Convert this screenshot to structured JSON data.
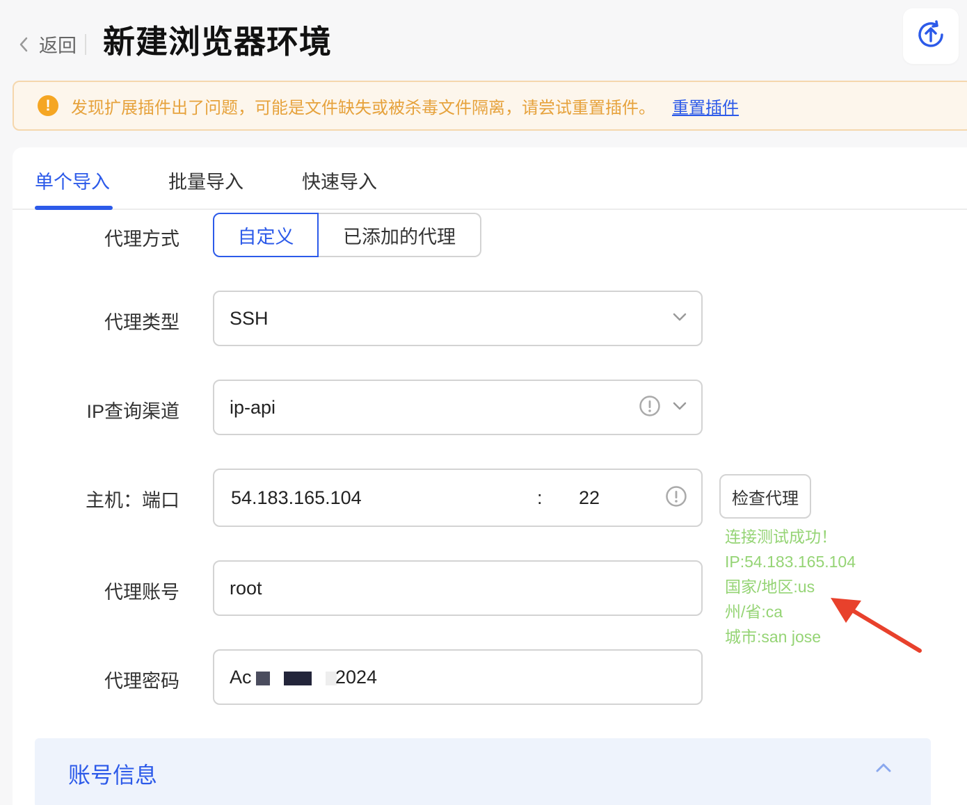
{
  "header": {
    "back_label": "返回",
    "title": "新建浏览器环境",
    "upload_icon": "upload-sync-icon"
  },
  "banner": {
    "icon": "warning-icon",
    "message": "发现扩展插件出了问题，可能是文件缺失或被杀毒文件隔离，请尝试重置插件。",
    "link": "重置插件",
    "color": "#e6a23c"
  },
  "tabs": [
    {
      "label": "单个导入",
      "active": true
    },
    {
      "label": "批量导入",
      "active": false
    },
    {
      "label": "快速导入",
      "active": false
    }
  ],
  "form": {
    "proxy_mode": {
      "label": "代理方式",
      "options": [
        "自定义",
        "已添加的代理"
      ],
      "selected": "自定义"
    },
    "proxy_type": {
      "label": "代理类型",
      "value": "SSH"
    },
    "ip_channel": {
      "label": "IP查询渠道",
      "value": "ip-api"
    },
    "host_port": {
      "label": "主机：端口",
      "host": "54.183.165.104",
      "separator": ":",
      "port": "22"
    },
    "account": {
      "label": "代理账号",
      "value": "root"
    },
    "password": {
      "label": "代理密码",
      "value_prefix": "Ac",
      "value_suffix": "2024"
    }
  },
  "check_proxy": {
    "button_label": "检查代理",
    "result_lines": [
      "连接测试成功！",
      "IP:54.183.165.104",
      "国家/地区:us",
      "州/省:ca",
      "城市:san jose"
    ],
    "result_color": "#95d475"
  },
  "account_section": {
    "title": "账号信息"
  },
  "colors": {
    "accent": "#2c5ae9",
    "annotation_arrow": "#e8412c"
  }
}
